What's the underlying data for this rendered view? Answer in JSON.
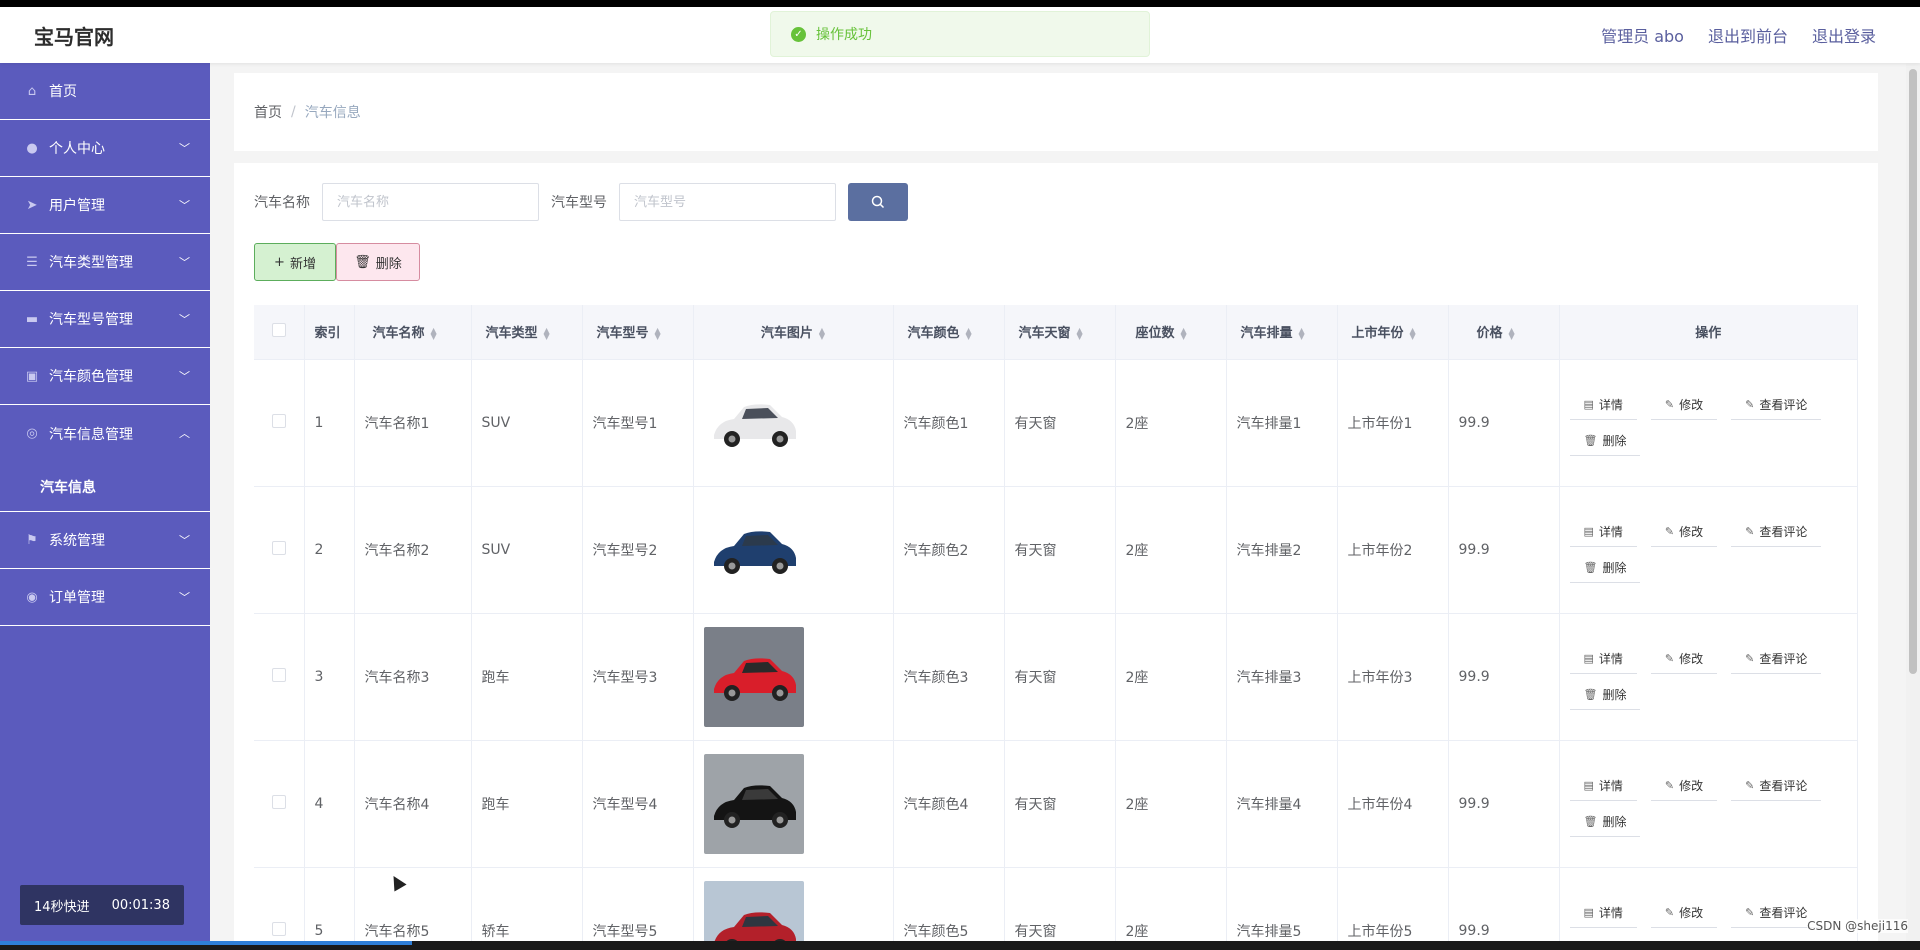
{
  "header": {
    "brand": "宝马官网",
    "toast": "操作成功",
    "user": "管理员 abo",
    "to_front": "退出到前台",
    "logout": "退出登录"
  },
  "sidebar": {
    "items": [
      {
        "label": "首页",
        "icon": "home-icon",
        "arrow": ""
      },
      {
        "label": "个人中心",
        "icon": "user-icon",
        "arrow": "﹀"
      },
      {
        "label": "用户管理",
        "icon": "send-icon",
        "arrow": "﹀"
      },
      {
        "label": "汽车类型管理",
        "icon": "list-icon",
        "arrow": "﹀"
      },
      {
        "label": "汽车型号管理",
        "icon": "printer-icon",
        "arrow": "﹀"
      },
      {
        "label": "汽车颜色管理",
        "icon": "trash-icon",
        "arrow": "﹀"
      },
      {
        "label": "汽车信息管理",
        "icon": "target-icon",
        "arrow": "︿"
      }
    ],
    "sub_item": "汽车信息",
    "items_after": [
      {
        "label": "系统管理",
        "icon": "flag-icon",
        "arrow": "﹀"
      },
      {
        "label": "订单管理",
        "icon": "coin-icon",
        "arrow": "﹀"
      }
    ],
    "timer_label": "14秒快进",
    "timer_value": "00:01:38"
  },
  "breadcrumb": {
    "home": "首页",
    "sep": "/",
    "current": "汽车信息"
  },
  "search": {
    "name_label": "汽车名称",
    "name_placeholder": "汽车名称",
    "model_label": "汽车型号",
    "model_placeholder": "汽车型号"
  },
  "actions": {
    "add": "新增",
    "delete": "删除"
  },
  "table": {
    "columns": [
      "索引",
      "汽车名称",
      "汽车类型",
      "汽车型号",
      "汽车图片",
      "汽车颜色",
      "汽车天窗",
      "座位数",
      "汽车排量",
      "上市年份",
      "价格",
      "操作"
    ],
    "ops": {
      "detail": "详情",
      "edit": "修改",
      "review": "查看评论",
      "delete": "删除"
    },
    "rows": [
      {
        "idx": "1",
        "name": "汽车名称1",
        "type": "SUV",
        "model": "汽车型号1",
        "image": "white-suv",
        "color": "汽车颜色1",
        "sunroof": "有天窗",
        "seats": "2座",
        "displacement": "汽车排量1",
        "year": "上市年份1",
        "price": "99.9"
      },
      {
        "idx": "2",
        "name": "汽车名称2",
        "type": "SUV",
        "model": "汽车型号2",
        "image": "blue-suv",
        "color": "汽车颜色2",
        "sunroof": "有天窗",
        "seats": "2座",
        "displacement": "汽车排量2",
        "year": "上市年份2",
        "price": "99.9"
      },
      {
        "idx": "3",
        "name": "汽车名称3",
        "type": "跑车",
        "model": "汽车型号3",
        "image": "red-sports-car",
        "color": "汽车颜色3",
        "sunroof": "有天窗",
        "seats": "2座",
        "displacement": "汽车排量3",
        "year": "上市年份3",
        "price": "99.9"
      },
      {
        "idx": "4",
        "name": "汽车名称4",
        "type": "跑车",
        "model": "汽车型号4",
        "image": "black-convertible",
        "color": "汽车颜色4",
        "sunroof": "有天窗",
        "seats": "2座",
        "displacement": "汽车排量4",
        "year": "上市年份4",
        "price": "99.9"
      },
      {
        "idx": "5",
        "name": "汽车名称5",
        "type": "轿车",
        "model": "汽车型号5",
        "image": "red-sedan",
        "color": "汽车颜色5",
        "sunroof": "有天窗",
        "seats": "2座",
        "displacement": "汽车排量5",
        "year": "上市年份5",
        "price": "99.9"
      }
    ]
  },
  "watermark": "CSDN @sheji116",
  "colors": {
    "sidebar": "#5b5bbd",
    "accent": "#5a5f9e",
    "success": "#67c23a"
  }
}
